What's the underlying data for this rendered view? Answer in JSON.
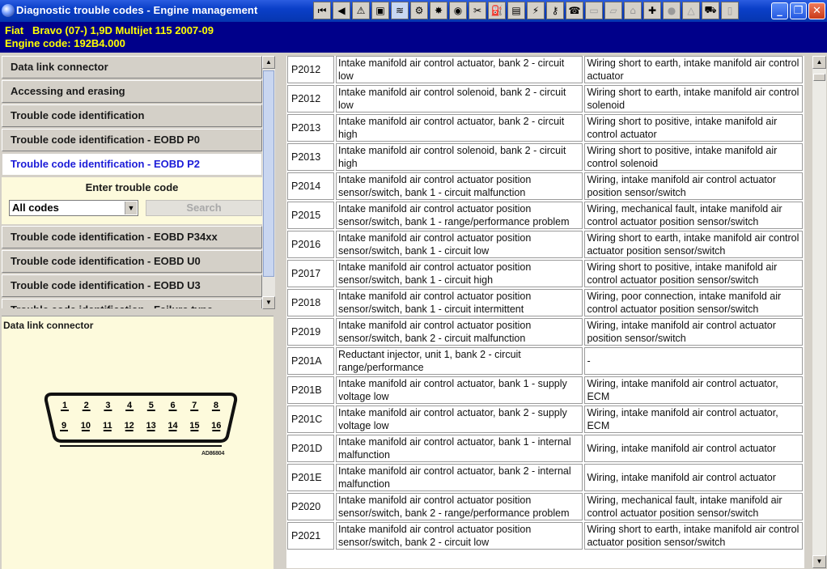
{
  "window": {
    "title": "Diagnostic trouble codes - Engine management",
    "minimize": "_",
    "restore": "❐",
    "close": "✕"
  },
  "toolbar": [
    {
      "name": "first-page-icon",
      "glyph": "⏮",
      "state": "normal"
    },
    {
      "name": "back-icon",
      "glyph": "◀",
      "state": "normal"
    },
    {
      "name": "warning-icon",
      "glyph": "⚠",
      "state": "normal"
    },
    {
      "name": "component-location-icon",
      "glyph": "▣",
      "state": "normal"
    },
    {
      "name": "dtc-icon",
      "glyph": "≋",
      "state": "active"
    },
    {
      "name": "engine-icon",
      "glyph": "⚙",
      "state": "normal"
    },
    {
      "name": "adjustment-icon",
      "glyph": "✸",
      "state": "normal"
    },
    {
      "name": "timing-icon",
      "glyph": "◉",
      "state": "normal"
    },
    {
      "name": "tools-icon",
      "glyph": "✂",
      "state": "normal"
    },
    {
      "name": "brake-icon",
      "glyph": "⛽",
      "state": "normal"
    },
    {
      "name": "battery-icon",
      "glyph": "▤",
      "state": "normal"
    },
    {
      "name": "electrical-icon",
      "glyph": "⚡",
      "state": "normal"
    },
    {
      "name": "key-icon",
      "glyph": "⚷",
      "state": "normal"
    },
    {
      "name": "service-icon",
      "glyph": "☎",
      "state": "normal"
    },
    {
      "name": "car-icon",
      "glyph": "▭",
      "state": "dim"
    },
    {
      "name": "body-icon",
      "glyph": "▱",
      "state": "dim"
    },
    {
      "name": "repair-icon",
      "glyph": "⌂",
      "state": "dim"
    },
    {
      "name": "diagnostic-icon",
      "glyph": "✚",
      "state": "normal"
    },
    {
      "name": "airbag-icon",
      "glyph": "●",
      "state": "dim"
    },
    {
      "name": "hazard-icon",
      "glyph": "△",
      "state": "dim"
    },
    {
      "name": "gearbox-icon",
      "glyph": "⛟",
      "state": "normal"
    },
    {
      "name": "notes-icon",
      "glyph": "▯",
      "state": "dim"
    }
  ],
  "vehicle": {
    "line1": "Fiat   Bravo (07-) 1,9D Multijet 115 2007-09",
    "line2": "Engine code: 192B4.000"
  },
  "menu": {
    "items": [
      "Data link connector",
      "Accessing and erasing",
      "Trouble code identification",
      "Trouble code identification - EOBD P0",
      "Trouble code identification - EOBD P2",
      "Trouble code identification - EOBD P34xx",
      "Trouble code identification - EOBD U0",
      "Trouble code identification - EOBD U3",
      "Trouble code identification - Failure type"
    ],
    "search": {
      "label": "Enter trouble code",
      "selected_option": "All codes",
      "button": "Search"
    }
  },
  "connector": {
    "title": "Data link connector",
    "pins_top": [
      "1",
      "2",
      "3",
      "4",
      "5",
      "6",
      "7",
      "8"
    ],
    "pins_bottom": [
      "9",
      "10",
      "11",
      "12",
      "13",
      "14",
      "15",
      "16"
    ],
    "ref": "AD86804"
  },
  "codes": [
    {
      "code": "P2012",
      "description": "Intake manifold air control actuator, bank 2 - circuit low",
      "cause": "Wiring short to earth, intake manifold air control actuator"
    },
    {
      "code": "P2012",
      "description": "Intake manifold air control solenoid, bank 2 - circuit low",
      "cause": "Wiring short to earth, intake manifold air control solenoid"
    },
    {
      "code": "P2013",
      "description": "Intake manifold air control actuator, bank 2 - circuit high",
      "cause": "Wiring short to positive, intake manifold air control actuator"
    },
    {
      "code": "P2013",
      "description": "Intake manifold air control solenoid, bank 2 - circuit high",
      "cause": "Wiring short to positive, intake manifold air control solenoid"
    },
    {
      "code": "P2014",
      "description": "Intake manifold air control actuator position sensor/switch, bank 1 - circuit malfunction",
      "cause": "Wiring, intake manifold air control actuator position sensor/switch"
    },
    {
      "code": "P2015",
      "description": "Intake manifold air control actuator position sensor/switch, bank 1 - range/performance problem",
      "cause": "Wiring, mechanical fault, intake manifold air control actuator position sensor/switch"
    },
    {
      "code": "P2016",
      "description": "Intake manifold air control actuator position sensor/switch, bank 1 - circuit low",
      "cause": "Wiring short to earth, intake manifold air control actuator position sensor/switch"
    },
    {
      "code": "P2017",
      "description": "Intake manifold air control actuator position sensor/switch, bank 1 - circuit high",
      "cause": "Wiring short to positive, intake manifold air control actuator position sensor/switch"
    },
    {
      "code": "P2018",
      "description": "Intake manifold air control actuator position sensor/switch, bank 1 - circuit intermittent",
      "cause": "Wiring, poor connection, intake manifold air control actuator position sensor/switch"
    },
    {
      "code": "P2019",
      "description": "Intake manifold air control actuator position sensor/switch, bank 2 - circuit malfunction",
      "cause": "Wiring, intake manifold air control actuator position sensor/switch"
    },
    {
      "code": "P201A",
      "description": "Reductant injector, unit 1, bank 2 - circuit range/performance",
      "cause": "-"
    },
    {
      "code": "P201B",
      "description": "Intake manifold air control actuator, bank 1 - supply voltage low",
      "cause": "Wiring, intake manifold air control actuator, ECM"
    },
    {
      "code": "P201C",
      "description": "Intake manifold air control actuator, bank 2 - supply voltage low",
      "cause": "Wiring, intake manifold air control actuator, ECM"
    },
    {
      "code": "P201D",
      "description": "Intake manifold air control actuator, bank 1 - internal malfunction",
      "cause": "Wiring, intake manifold air control actuator"
    },
    {
      "code": "P201E",
      "description": "Intake manifold air control actuator, bank 2 - internal malfunction",
      "cause": "Wiring, intake manifold air control actuator"
    },
    {
      "code": "P2020",
      "description": "Intake manifold air control actuator position sensor/switch, bank 2 - range/performance problem",
      "cause": "Wiring, mechanical fault, intake manifold air control actuator position sensor/switch"
    },
    {
      "code": "P2021",
      "description": "Intake manifold air control actuator position sensor/switch, bank 2 - circuit low",
      "cause": "Wiring short to earth, intake manifold air control actuator position sensor/switch"
    }
  ]
}
